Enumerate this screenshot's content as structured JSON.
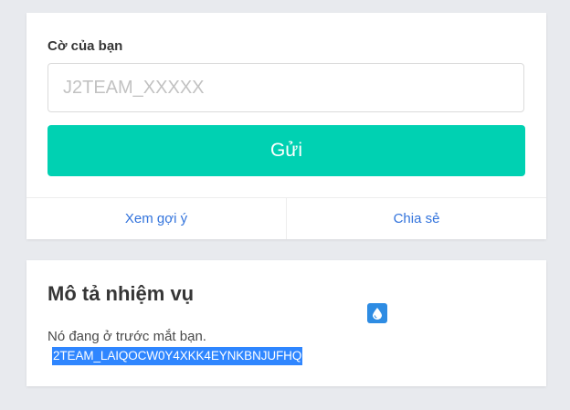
{
  "flag_form": {
    "label": "Cờ của bạn",
    "input_placeholder": "J2TEAM_XXXXX",
    "input_value": "",
    "submit_label": "Gửi",
    "footer": {
      "hint_label": "Xem gợi ý",
      "share_label": "Chia sẻ"
    }
  },
  "description": {
    "title": "Mô tả nhiệm vụ",
    "text": "Nó đang ở trước mắt bạn.",
    "highlighted_flag": "2TEAM_LAIQOCW0Y4XKK4EYNKBNJUFHQ",
    "badge_icon": "water-drop-icon"
  },
  "colors": {
    "accent": "#00d1b2",
    "link": "#3273dc",
    "selection": "#2f86ff",
    "badge": "#2e8ce3"
  }
}
